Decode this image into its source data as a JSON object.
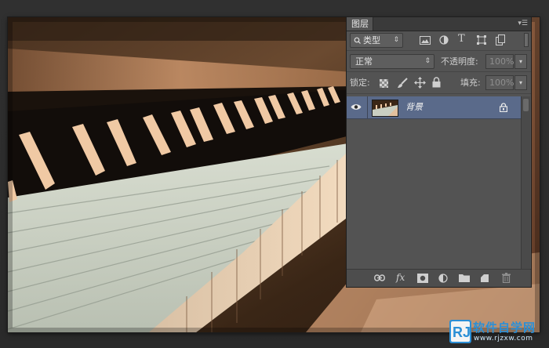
{
  "layers_panel": {
    "tab_title": "图层",
    "panel_menu_icon": "panel-menu-icon",
    "filter": {
      "kind_label": "类型",
      "icons": [
        "image-filter-icon",
        "adjustment-filter-icon",
        "type-filter-icon",
        "shape-filter-icon",
        "smart-object-filter-icon"
      ]
    },
    "blend": {
      "mode_value": "正常",
      "opacity_label": "不透明度:",
      "opacity_value": "100%"
    },
    "lock": {
      "label": "锁定:",
      "icons": [
        "lock-transparent-icon",
        "lock-image-icon",
        "lock-position-icon",
        "lock-all-icon"
      ],
      "fill_label": "填充:",
      "fill_value": "100%"
    },
    "layers": [
      {
        "name": "背景",
        "visible": true,
        "locked": true,
        "selected": true
      }
    ],
    "bottom_icons": [
      "link-layers-icon",
      "fx-icon",
      "layer-mask-icon",
      "adjustment-layer-icon",
      "new-group-icon",
      "new-layer-icon",
      "trash-icon"
    ],
    "fx_label": "fx"
  },
  "watermark": {
    "logo_letters": "RJ",
    "name": "软件自学网",
    "url": "www.rjzxw.com"
  },
  "colors": {
    "panel_bg": "#535353",
    "selected_layer": "#5a6a8a",
    "workspace": "#2b2b2b",
    "watermark_blue": "#2b8fd6"
  }
}
